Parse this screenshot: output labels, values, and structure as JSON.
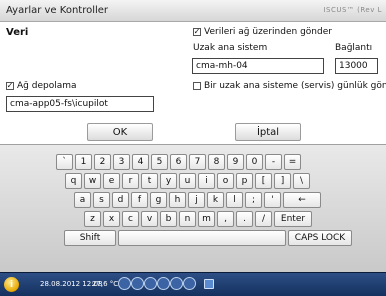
{
  "window": {
    "title": "Ayarlar ve Kontroller",
    "brand": "ISCUS™ (Rev L"
  },
  "settings": {
    "section_title": "Veri",
    "send_over_network": {
      "label": "Verileri ağ üzerinden gönder",
      "checked": true
    },
    "remote_host": {
      "label": "Uzak ana sistem",
      "value": "cma-mh-04"
    },
    "connection": {
      "label": "Bağlantı",
      "value": "13000"
    },
    "network_storage": {
      "label": "Ağ depolama",
      "checked": true,
      "value": "cma-app05-fs\\icupilot"
    },
    "service_log": {
      "label": "Bir uzak ana sisteme (servis) günlük gönder",
      "checked": false
    }
  },
  "actions": {
    "ok_label": "OK",
    "cancel_label": "İptal"
  },
  "keyboard": {
    "row1": [
      "`",
      "1",
      "2",
      "3",
      "4",
      "5",
      "6",
      "7",
      "8",
      "9",
      "0",
      "-",
      "="
    ],
    "row2": [
      "q",
      "w",
      "e",
      "r",
      "t",
      "y",
      "u",
      "i",
      "o",
      "p",
      "[",
      "]",
      "\\"
    ],
    "row3": [
      "a",
      "s",
      "d",
      "f",
      "g",
      "h",
      "j",
      "k",
      "l",
      ";",
      "'",
      "←"
    ],
    "row4": [
      "z",
      "x",
      "c",
      "v",
      "b",
      "n",
      "m",
      ",",
      ".",
      "/",
      "Enter"
    ],
    "shift": "Shift",
    "caps": "CAPS LOCK"
  },
  "taskbar": {
    "start_glyph": "i",
    "datetime": "28.08.2012 12:08",
    "temperature": "27,6 °C"
  }
}
